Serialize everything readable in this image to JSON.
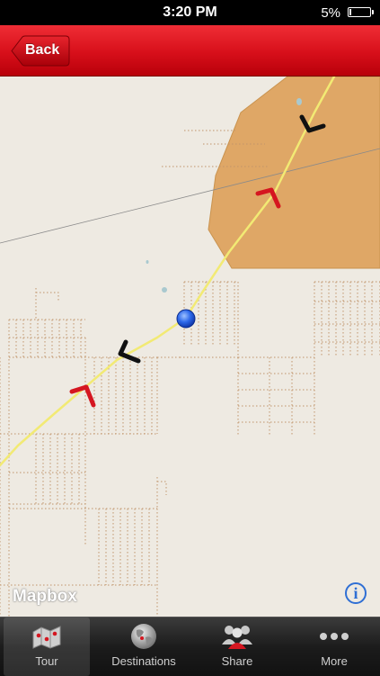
{
  "status_bar": {
    "time": "3:20 PM",
    "battery": "5%"
  },
  "nav": {
    "back_label": "Back",
    "accent_color": "#d70f1a"
  },
  "map": {
    "attribution": "Mapbox",
    "info_label": "i",
    "background_color": "#eeeae2",
    "shaded_area_color": "#dfa766",
    "route_color": "#f2ea74",
    "current_location_color": "#1f55e0",
    "markers": [
      {
        "name": "direction-marker-black",
        "color": "#111111"
      },
      {
        "name": "direction-marker-red",
        "color": "#d51620"
      },
      {
        "name": "direction-marker-black",
        "color": "#111111"
      },
      {
        "name": "direction-marker-red",
        "color": "#d51620"
      }
    ]
  },
  "tabs": [
    {
      "label": "Tour",
      "icon": "map-icon",
      "active": true
    },
    {
      "label": "Destinations",
      "icon": "globe-icon",
      "active": false
    },
    {
      "label": "Share",
      "icon": "people-icon",
      "active": false
    },
    {
      "label": "More",
      "icon": "more-icon",
      "active": false
    }
  ]
}
